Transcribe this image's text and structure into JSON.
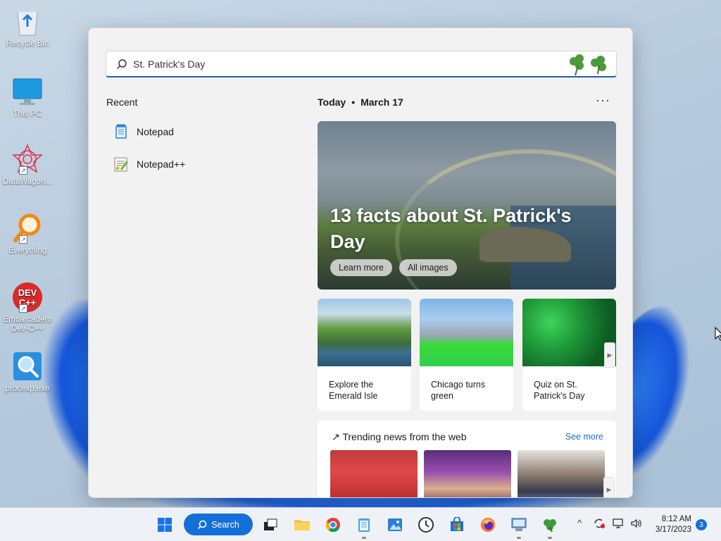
{
  "desktop": {
    "icons": [
      {
        "label": "Recycle Bin"
      },
      {
        "label": "This PC"
      },
      {
        "label": "DataWagon..."
      },
      {
        "label": "Everything"
      },
      {
        "label": "Embarcadero Dev-C++"
      },
      {
        "label": "procexp.exe"
      }
    ]
  },
  "search": {
    "value": "St. Patrick's Day"
  },
  "recent": {
    "title": "Recent",
    "items": [
      {
        "label": "Notepad",
        "icon": "notepad-icon"
      },
      {
        "label": "Notepad++",
        "icon": "notepadplusplus-icon"
      }
    ]
  },
  "highlights": {
    "today_label": "Today",
    "date": "March 17",
    "more": "···",
    "hero": {
      "headline": "13 facts about St. Patrick's Day",
      "learn_more": "Learn more",
      "all_images": "All images"
    },
    "cards": [
      {
        "caption": "Explore the Emerald Isle"
      },
      {
        "caption": "Chicago turns green"
      },
      {
        "caption": "Quiz on St. Patrick's Day"
      }
    ]
  },
  "trending": {
    "title": "Trending news from the web",
    "see_more": "See more"
  },
  "taskbar": {
    "search_label": "Search",
    "time": "8:12 AM",
    "date": "3/17/2023",
    "notification_count": "3"
  },
  "colors": {
    "accent": "#1470d8",
    "link": "#1a6fc9",
    "panel_bg": "#f2f2f2"
  }
}
